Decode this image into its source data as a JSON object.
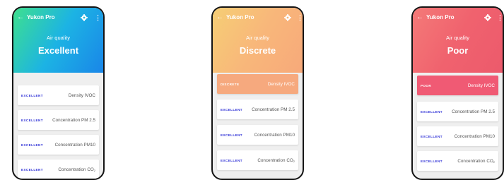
{
  "screens": [
    {
      "app_title": "Yukon Pro",
      "subtitle": "Air quality",
      "status": "Excellent",
      "gradient": [
        "#3ee08e",
        "#1cb3e4",
        "#1a86e8"
      ],
      "items": [
        {
          "level": "EXCELLENT",
          "name": "Density IVOC",
          "sub": ""
        },
        {
          "level": "EXCELLENT",
          "name": "Concentration PM 2.5",
          "sub": ""
        },
        {
          "level": "EXCELLENT",
          "name": "Concentration PM10",
          "sub": ""
        },
        {
          "level": "EXCELLENT",
          "name": "Concentration CO",
          "sub": "2"
        }
      ]
    },
    {
      "app_title": "Yukon Pro",
      "subtitle": "Air quality",
      "status": "Discrete",
      "gradient": [
        "#f6ce75",
        "#f8b77a",
        "#f7a97a"
      ],
      "highlight_color": "#f6a97e",
      "items": [
        {
          "level": "DISCRETE",
          "name": "Density IVOC",
          "sub": ""
        },
        {
          "level": "EXCELLENT",
          "name": "Concentration PM 2.5",
          "sub": ""
        },
        {
          "level": "EXCELLENT",
          "name": "Concentration PM10",
          "sub": ""
        },
        {
          "level": "EXCELLENT",
          "name": "Concentration CO",
          "sub": "2"
        }
      ]
    },
    {
      "app_title": "Yukon Pro",
      "subtitle": "Air quality",
      "status": "Poor",
      "gradient": [
        "#f47a78",
        "#f0626e",
        "#ec5a6c"
      ],
      "highlight_color": "#f05a74",
      "items": [
        {
          "level": "POOR",
          "name": "Density IVOC",
          "sub": ""
        },
        {
          "level": "EXCELLENT",
          "name": "Concentration PM 2.5",
          "sub": ""
        },
        {
          "level": "EXCELLENT",
          "name": "Concentration PM10",
          "sub": ""
        },
        {
          "level": "EXCELLENT",
          "name": "Concentration CO",
          "sub": "2"
        }
      ]
    }
  ],
  "colors": {
    "level_text": "#2d2fd6"
  },
  "icons": [
    "back-arrow-icon",
    "settings-gear-icon",
    "more-vertical-icon"
  ]
}
